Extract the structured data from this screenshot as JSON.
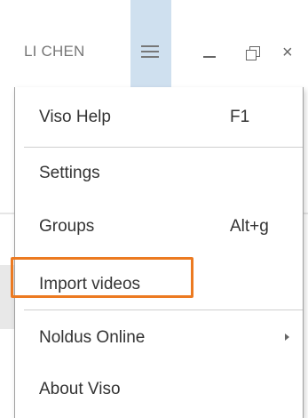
{
  "window": {
    "user_name": "LI CHEN",
    "close_glyph": "×"
  },
  "menu": {
    "items": [
      {
        "label": "Viso Help",
        "shortcut": "F1"
      },
      {
        "label": "Settings",
        "shortcut": ""
      },
      {
        "label": "Groups",
        "shortcut": "Alt+g"
      },
      {
        "label": "Import videos",
        "shortcut": ""
      },
      {
        "label": "Noldus Online",
        "shortcut": "",
        "has_submenu": true
      },
      {
        "label": "About Viso",
        "shortcut": ""
      }
    ]
  },
  "colors": {
    "hamburger_active_bg": "#cfe0ef",
    "highlight_outline": "#ec7a21",
    "text": "#333333"
  },
  "icons": {
    "menu": "hamburger-icon",
    "minimize": "minimize-icon",
    "restore": "restore-icon",
    "close": "close-icon",
    "submenu": "chevron-right-icon"
  }
}
